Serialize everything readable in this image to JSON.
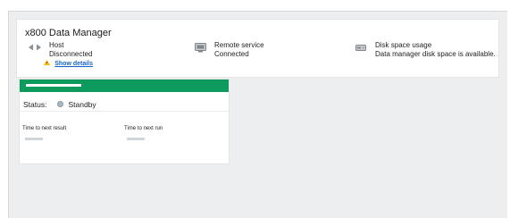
{
  "app": {
    "title": "x800 Data Manager"
  },
  "statuses": {
    "host": {
      "icon": "host-connection-icon",
      "label": "Host",
      "value": "Disconnected",
      "warning_icon": "warning-icon",
      "link": "Show details"
    },
    "remote_service": {
      "icon": "remote-service-icon",
      "label": "Remote service",
      "value": "Connected"
    },
    "disk_space": {
      "icon": "disk-icon",
      "label": "Disk space usage",
      "value": "Data manager disk space is available."
    }
  },
  "job_card": {
    "bar_color": "#0d9a5d",
    "status_label": "Status:",
    "status_value": "Standby",
    "status_dot_color": "#a9b7c2",
    "time_to_next_result_label": "Time to next result",
    "time_to_next_run_label": "Time to next run"
  },
  "colors": {
    "accent": "#0d9a5d",
    "link": "#1565c0",
    "warning": "#f2b705",
    "background": "#eceef0"
  }
}
